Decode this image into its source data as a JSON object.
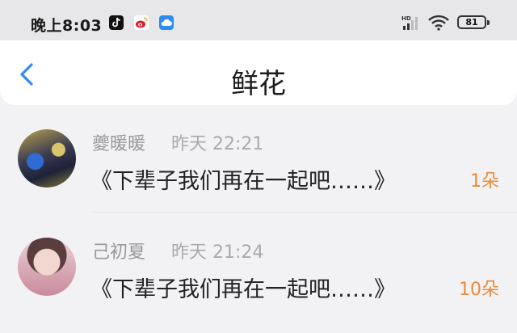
{
  "status_bar": {
    "time": "晚上8:03",
    "battery": "81",
    "network_label": "HD"
  },
  "header": {
    "title": "鲜花"
  },
  "items": [
    {
      "username": "夔暖暖",
      "time": "昨天 22:21",
      "book": "《下辈子我们再在一起吧……》",
      "count": "1朵"
    },
    {
      "username": "己初夏",
      "time": "昨天 21:24",
      "book": "《下辈子我们再在一起吧……》",
      "count": "10朵"
    }
  ],
  "colors": {
    "accent": "#2e8cf0",
    "flower_count": "#e98a38",
    "background": "#f2f2f4"
  }
}
